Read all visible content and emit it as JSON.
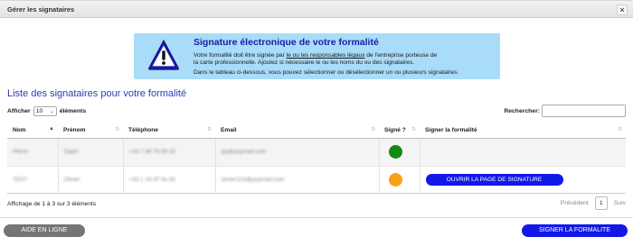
{
  "dialog": {
    "title": "Gérer les signataires",
    "close_label": "×"
  },
  "banner": {
    "title": "Signature électronique de votre formalité",
    "line1_pre": "Votre formalité doit être signée par ",
    "line1_link": "le ou les responsables légaux",
    "line1_post": " de l'entreprise porteuse de",
    "line2": "la carte professionnelle. Ajoutez si nécessaire le ou les noms du ou des signataires.",
    "line3": "Dans le tableau ci-dessous, vous pouvez sélectionner ou désélectionner un ou plusieurs signataires.",
    "icon": "warning-triangle-icon"
  },
  "section_title": "Liste des signataires pour votre formalité",
  "length": {
    "prefix": "Afficher",
    "value": "10",
    "suffix": "éléments"
  },
  "search": {
    "label": "Rechercher:",
    "value": ""
  },
  "table": {
    "columns": [
      "Nom",
      "Prénom",
      "Téléphone",
      "Email",
      "Signé ?",
      "Signer la formalité"
    ],
    "rows": [
      {
        "nom": "Pierre",
        "prenom": "Sapin",
        "telephone": "+33 7 88 78 56 32",
        "email": "pp@yopmail.com",
        "signed_color": "#138a13",
        "action": ""
      },
      {
        "nom": "TEST",
        "prenom": "Olivier",
        "telephone": "+33 1 23 47 6x 43",
        "email": "olivier123@yopmail.com",
        "signed_color": "#f9a01b",
        "action": "OUVRIR LA PAGE DE SIGNATURE"
      }
    ]
  },
  "info": "Affichage de 1 à 3 sur 3 éléments",
  "pager": {
    "previous": "Précédent",
    "page": "1",
    "next": "Suiv"
  },
  "footer": {
    "help_label": "AIDE EN LIGNE",
    "sign_label": "SIGNER LA FORMALITE"
  },
  "colors": {
    "accent": "#1218e8",
    "banner_bg": "#a8dcf8",
    "title_blue": "#2a3bb5"
  }
}
